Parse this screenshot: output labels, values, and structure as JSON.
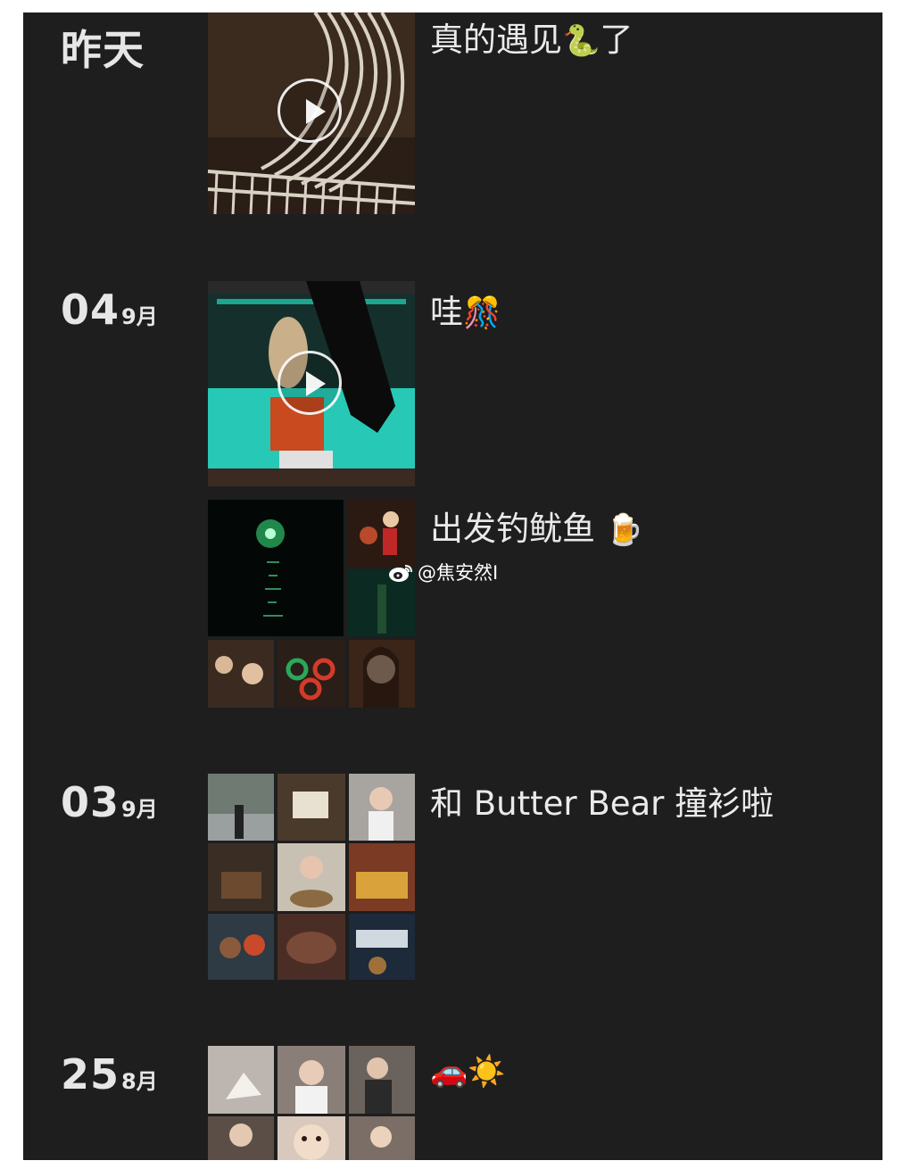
{
  "entries": [
    {
      "day": "昨天",
      "month": "",
      "caption_text": "真的遇见",
      "caption_emoji": "🐍",
      "caption_tail": "了"
    },
    {
      "day": "04",
      "month": "9月",
      "caption_text": "哇",
      "caption_emoji": "🎊"
    },
    {
      "caption_text": "出发钓鱿鱼",
      "caption_emoji": "🍺"
    },
    {
      "day": "03",
      "month": "9月",
      "caption_text": "和 Butter Bear 撞衫啦"
    },
    {
      "day": "25",
      "month": "8月",
      "caption_emoji": "🚗☀️"
    }
  ],
  "watermark": {
    "text": "@焦安然I"
  },
  "colors": {
    "background": "#1e1e1e",
    "text": "#e6e6e6",
    "page": "#ffffff"
  },
  "icons": [
    "play-icon",
    "weibo-logo-icon"
  ]
}
